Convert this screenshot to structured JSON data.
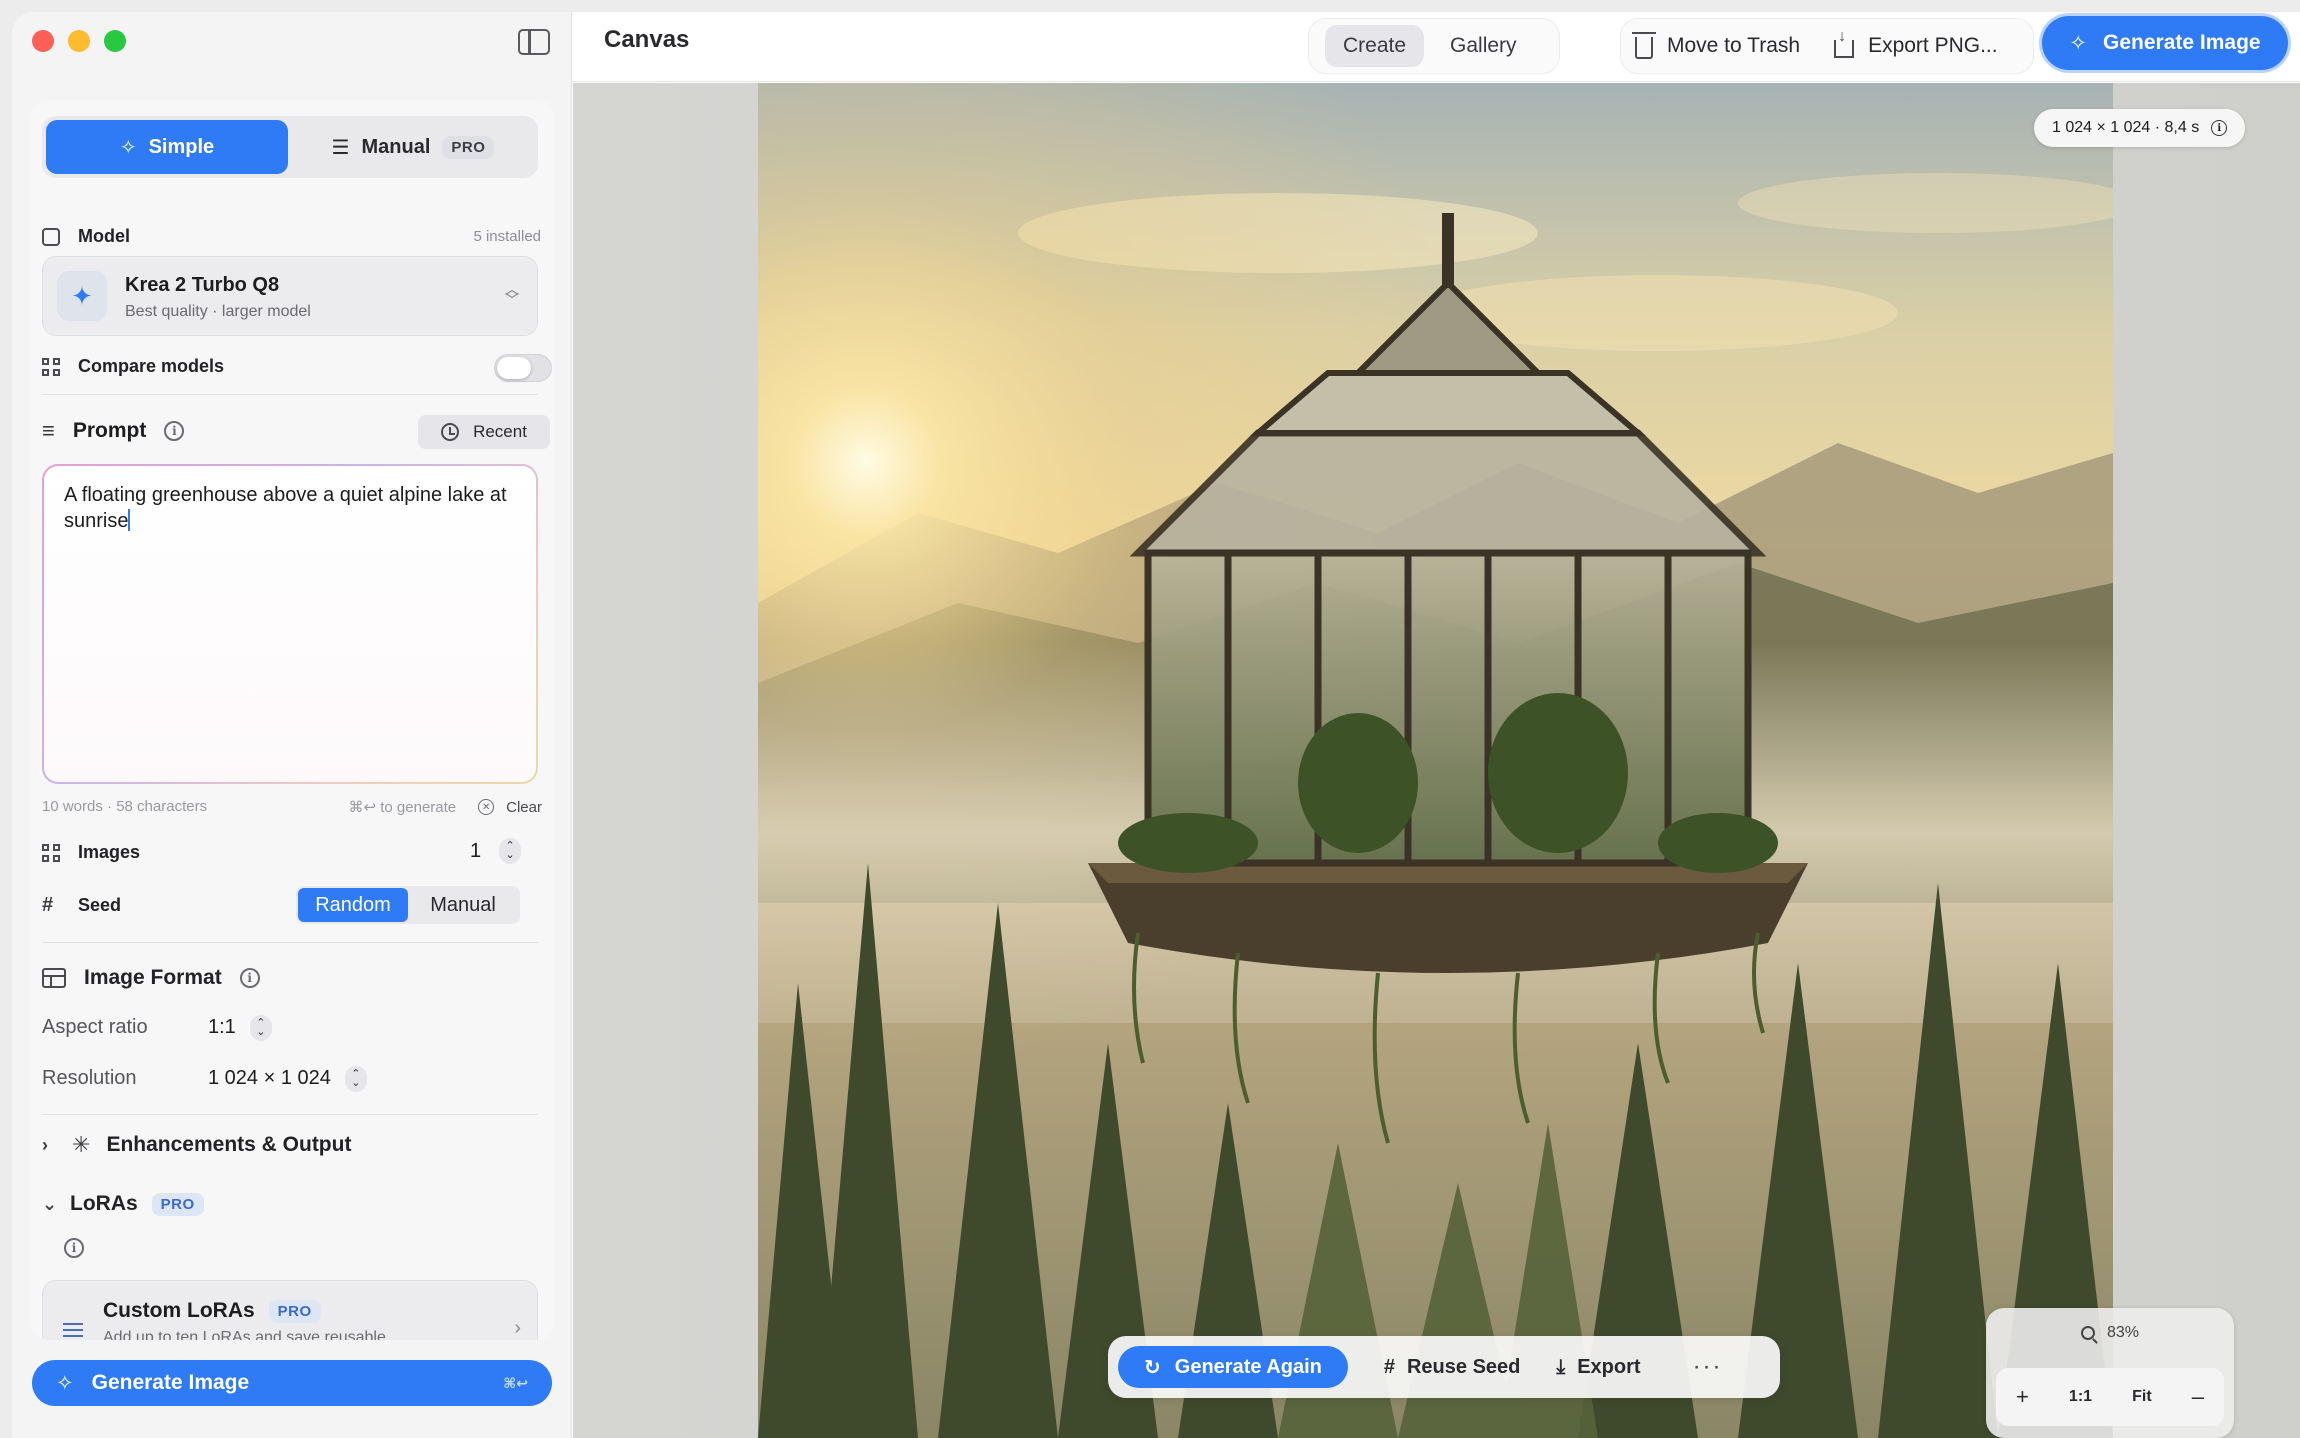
{
  "window": {
    "title": "Canvas"
  },
  "sidebar": {
    "mode_tabs": [
      {
        "label": "Simple",
        "active": true
      },
      {
        "label": "Manual",
        "badge": "PRO",
        "active": false
      }
    ],
    "model": {
      "label": "Model",
      "installed": "5 installed",
      "name": "Krea 2 Turbo Q8",
      "subtitle": "Best quality · larger model"
    },
    "compare": {
      "label": "Compare models",
      "enabled": false
    },
    "prompt": {
      "title": "Prompt",
      "recent_label": "Recent",
      "text": "A floating greenhouse above a quiet alpine lake at sunrise",
      "stats": "10 words · 58 characters",
      "shortcut_hint": "⌘↩ to generate",
      "clear_label": "Clear"
    },
    "images": {
      "label": "Images",
      "value": "1"
    },
    "seed": {
      "label": "Seed",
      "options": [
        "Random",
        "Manual"
      ],
      "selected": "Random"
    },
    "image_format": {
      "title": "Image Format",
      "aspect_label": "Aspect ratio",
      "aspect_value": "1:1",
      "resolution_label": "Resolution",
      "resolution_value": "1 024 × 1 024"
    },
    "enhancements": {
      "title": "Enhancements & Output"
    },
    "loras": {
      "title": "LoRAs",
      "badge": "PRO",
      "card_title": "Custom LoRAs",
      "card_badge": "PRO",
      "card_subtitle": "Add up to ten LoRAs and save reusable"
    },
    "generate": {
      "label": "Generate Image",
      "shortcut": "⌘↩"
    }
  },
  "topbar": {
    "tabs": [
      {
        "label": "Create",
        "active": true
      },
      {
        "label": "Gallery",
        "active": false
      }
    ],
    "trash_label": "Move to Trash",
    "export_label": "Export PNG...",
    "generate_label": "Generate Image"
  },
  "canvas": {
    "meta": "1 024 × 1 024  ·  8,4 s",
    "actions": {
      "generate_again": "Generate Again",
      "reuse_seed": "Reuse Seed",
      "export": "Export",
      "more": "···"
    },
    "zoom": {
      "level": "83%",
      "plus": "+",
      "one_to_one": "1:1",
      "fit": "Fit",
      "minus": "–"
    }
  },
  "colors": {
    "accent": "#2f7bf5",
    "pro_badge_bg": "#dde6f5"
  }
}
